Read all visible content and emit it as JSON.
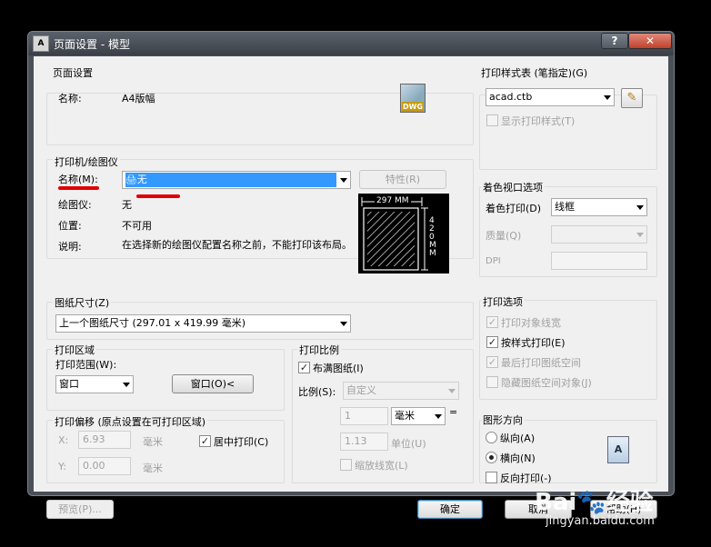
{
  "window": {
    "title": "页面设置 - 模型",
    "app_icon": "autocad-a-icon",
    "help_label": "?",
    "close_label": "✕"
  },
  "page_setup": {
    "group_label": "页面设置",
    "name_label": "名称:",
    "name_value": "A4版幅",
    "icon_label": "DWG"
  },
  "plotter": {
    "group_label": "打印机/绘图仪",
    "name_label": "名称(M):",
    "name_value": "无",
    "properties_button": "特性(R)",
    "plotter_label": "绘图仪:",
    "plotter_value": "无",
    "location_label": "位置:",
    "location_value": "不可用",
    "description_label": "说明:",
    "description_value": "在选择新的绘图仪配置名称之前，不能打印该布局。",
    "preview_width": "297 MM",
    "preview_height": "420 MM"
  },
  "paper_size": {
    "group_label": "图纸尺寸(Z)",
    "value": "上一个图纸尺寸 (297.01 x 419.99 毫米)"
  },
  "plot_area": {
    "group_label": "打印区域",
    "range_label": "打印范围(W):",
    "range_value": "窗口",
    "window_button": "窗口(O)<"
  },
  "plot_offset": {
    "group_label": "打印偏移 (原点设置在可打印区域)",
    "x_label": "X:",
    "x_value": "6.93",
    "x_unit": "毫米",
    "y_label": "Y:",
    "y_value": "0.00",
    "y_unit": "毫米",
    "center_label": "居中打印(C)",
    "center_checked": true
  },
  "plot_scale": {
    "group_label": "打印比例",
    "fit_label": "布满图纸(I)",
    "fit_checked": true,
    "scale_label": "比例(S):",
    "scale_value": "自定义",
    "num_value": "1",
    "unit_value": "毫米",
    "equals": "=",
    "den_value": "1.13",
    "den_unit": "单位(U)",
    "lineweight_label": "缩放线宽(L)"
  },
  "plot_style": {
    "group_label": "打印样式表 (笔指定)(G)",
    "value": "acad.ctb",
    "show_label": "显示打印样式(T)"
  },
  "shaded": {
    "group_label": "着色视口选项",
    "shade_label": "着色打印(D)",
    "shade_value": "线框",
    "quality_label": "质量(Q)",
    "quality_value": "",
    "dpi_label": "DPI",
    "dpi_value": ""
  },
  "plot_options": {
    "group_label": "打印选项",
    "items": [
      {
        "label": "打印对象线宽",
        "checked": true,
        "enabled": false
      },
      {
        "label": "按样式打印(E)",
        "checked": true,
        "enabled": true
      },
      {
        "label": "最后打印图纸空间",
        "checked": true,
        "enabled": false
      },
      {
        "label": "隐藏图纸空间对象(J)",
        "checked": false,
        "enabled": false
      }
    ]
  },
  "orientation": {
    "group_label": "图形方向",
    "portrait_label": "纵向(A)",
    "landscape_label": "横向(N)",
    "upside_down_label": "反向打印(-)",
    "selected": "landscape",
    "icon_label": "A"
  },
  "footer": {
    "preview_button": "预览(P)...",
    "ok_button": "确定",
    "cancel_button": "取消",
    "help_button": "帮助(H)"
  },
  "watermark": {
    "brand": "Bai",
    "brand2": "经验",
    "url": "jingyan.baidu.com"
  }
}
